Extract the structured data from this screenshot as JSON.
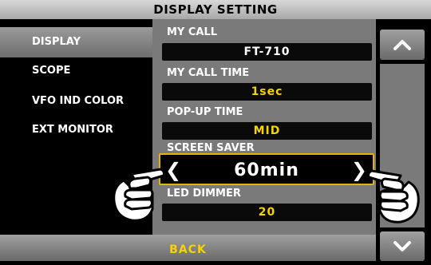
{
  "window": {
    "title": "DISPLAY SETTING"
  },
  "sidebar": {
    "items": [
      {
        "label": "DISPLAY"
      },
      {
        "label": "SCOPE"
      },
      {
        "label": "VFO IND COLOR"
      },
      {
        "label": "EXT MONITOR"
      }
    ]
  },
  "settings": {
    "rows": [
      {
        "label": "MY CALL",
        "value": "FT-710"
      },
      {
        "label": "MY CALL TIME",
        "value": "1sec"
      },
      {
        "label": "POP-UP TIME",
        "value": "MID"
      },
      {
        "label": "SCREEN SAVER",
        "value": "60min"
      },
      {
        "label": "LED DIMMER",
        "value": "20"
      }
    ]
  },
  "footer": {
    "back_label": "BACK"
  },
  "colors": {
    "accent": "#e2b600",
    "value_yellow": "#f5d400",
    "panel_gray": "#7a7a7a"
  },
  "icons": {
    "scroll_up": "chevron-up-icon",
    "scroll_down": "chevron-down-icon",
    "pointing_hand": "pointing-hand-icon"
  }
}
